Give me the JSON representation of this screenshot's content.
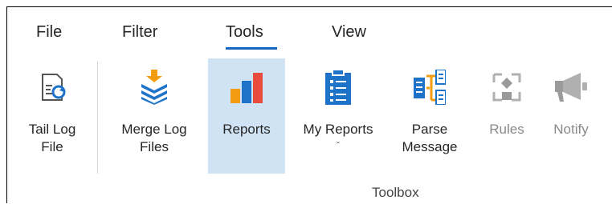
{
  "menu": {
    "file": "File",
    "filter": "Filter",
    "tools": "Tools",
    "view": "View"
  },
  "ribbon": {
    "buttons": [
      {
        "line1": "Tail Log",
        "line2": "File",
        "icon": "tail-log-icon"
      },
      {
        "line1": "Merge Log",
        "line2": "Files",
        "icon": "merge-icon"
      },
      {
        "line1": "Reports",
        "line2": "",
        "icon": "reports-icon"
      },
      {
        "line1": "My Reports",
        "line2": "ˇ",
        "icon": "my-reports-icon"
      },
      {
        "line1": "Parse",
        "line2": "Message",
        "icon": "parse-icon"
      },
      {
        "line1": "Rules",
        "line2": "",
        "icon": "rules-icon"
      },
      {
        "line1": "Notify",
        "line2": "",
        "icon": "notify-icon"
      }
    ],
    "group_label": "Toolbox"
  },
  "colors": {
    "accent": "#1565c0",
    "selected_bg": "#cfe3f5",
    "orange": "#f39c12",
    "red": "#e74c3c",
    "blue": "#1e73c8",
    "disabled": "#b0b0b0"
  }
}
